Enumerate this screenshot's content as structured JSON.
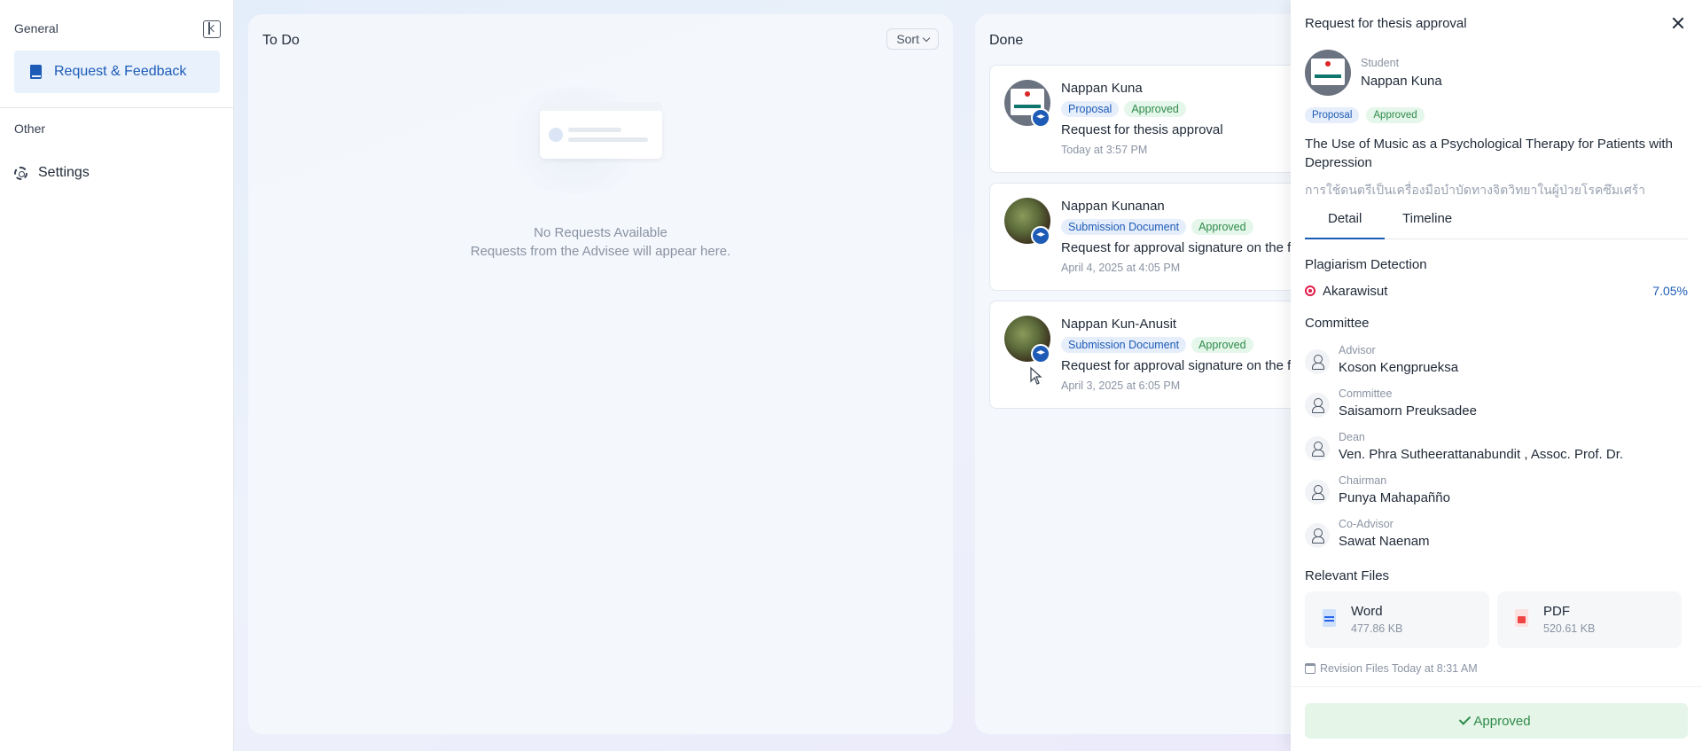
{
  "sidebar": {
    "general_title": "General",
    "items_general": [
      {
        "label": "Request & Feedback",
        "icon": "book-icon",
        "active": true
      }
    ],
    "other_title": "Other",
    "items_other": [
      {
        "label": "Settings",
        "icon": "gear-icon"
      }
    ]
  },
  "todo": {
    "title": "To Do",
    "sort_label": "Sort",
    "empty_title": "No Requests Available",
    "empty_sub": "Requests from the Advisee will appear here."
  },
  "done": {
    "title": "Done",
    "cards": [
      {
        "name": "Nappan Kuna",
        "tag": "Proposal",
        "status": "Approved",
        "title": "Request for thesis approval",
        "date": "Today at 3:57 PM"
      },
      {
        "name": "Nappan Kunanan",
        "tag": "Submission Document",
        "status": "Approved",
        "title": "Request for approval signature on the f",
        "date": "April 4, 2025 at 4:05 PM"
      },
      {
        "name": "Nappan Kun-Anusit",
        "tag": "Submission Document",
        "status": "Approved",
        "title": "Request for approval signature on the f",
        "date": "April 3, 2025 at 6:05 PM"
      }
    ]
  },
  "detail": {
    "header": "Request for thesis approval",
    "student_role": "Student",
    "student_name": "Nappan Kuna",
    "tag": "Proposal",
    "status": "Approved",
    "thesis_en": "The Use of Music as a Psychological Therapy for Patients with Depression",
    "thesis_th": "การใช้ดนตรีเป็นเครื่องมือบำบัดทางจิตวิทยาในผู้ป่วยโรคซึมเศร้า",
    "tabs": [
      "Detail",
      "Timeline"
    ],
    "plagiarism_title": "Plagiarism Detection",
    "plagiarism_tool": "Akarawisut",
    "plagiarism_value": "7.05%",
    "committee_title": "Committee",
    "committee": [
      {
        "role": "Advisor",
        "name": "Koson Kengprueksa"
      },
      {
        "role": "Committee",
        "name": "Saisamorn Preuksadee"
      },
      {
        "role": "Dean",
        "name": "Ven. Phra Sutheerattanabundit , Assoc. Prof. Dr."
      },
      {
        "role": "Chairman",
        "name": "Punya Mahapañño"
      },
      {
        "role": "Co-Advisor",
        "name": "Sawat Naenam"
      }
    ],
    "files_title": "Relevant Files",
    "files": [
      {
        "type": "Word",
        "size": "477.86 KB"
      },
      {
        "type": "PDF",
        "size": "520.61 KB"
      }
    ],
    "revision": "Revision Files Today at 8:31 AM",
    "approved_label": "Approved"
  },
  "colors": {
    "accent": "#1d5bb6",
    "approved_green": "#2e8b4a",
    "approved_bg": "#e5f5e8"
  }
}
